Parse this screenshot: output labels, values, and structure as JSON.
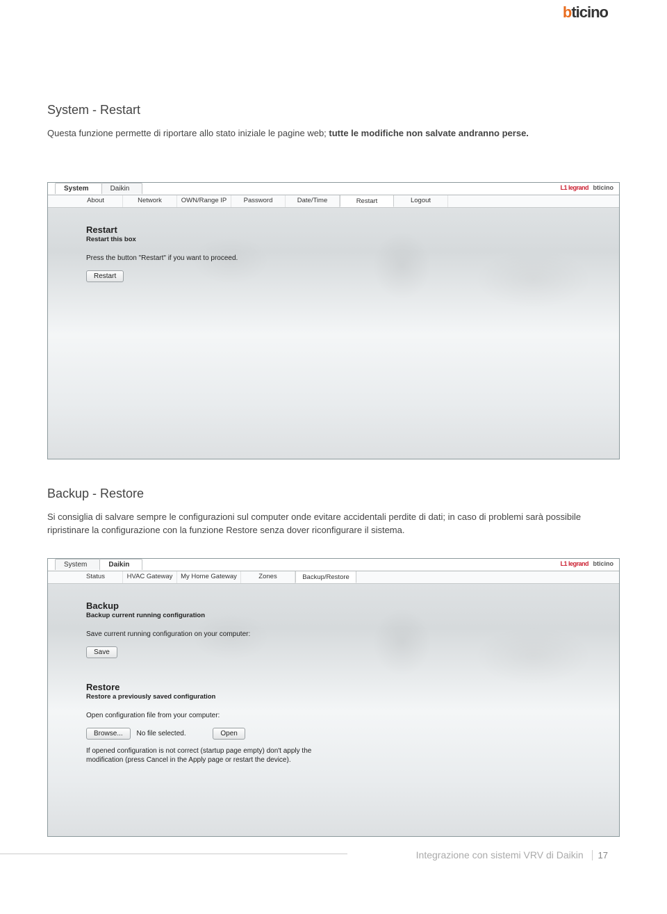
{
  "brand": {
    "part1": "b",
    "part2": "ticino"
  },
  "section1": {
    "title": "System - Restart",
    "desc_a": "Questa funzione permette di riportare allo stato iniziale le pagine web; ",
    "desc_b": "tutte le modifiche non salvate andranno perse."
  },
  "shot1": {
    "tabs": [
      "System",
      "Daikin"
    ],
    "active_tab": 0,
    "logos": {
      "legrand": "L1 legrand",
      "bticino": "bticino"
    },
    "subtabs": [
      "About",
      "Network",
      "OWN/Range IP",
      "Password",
      "Date/Time",
      "Restart",
      "Logout"
    ],
    "active_sub": 5,
    "heading": "Restart",
    "subheading": "Restart this box",
    "line": "Press the button \"Restart\" if you want to proceed.",
    "button": "Restart"
  },
  "section2": {
    "title": "Backup - Restore",
    "desc": "Si consiglia di salvare sempre le configurazioni sul computer onde evitare accidentali perdite di dati; in caso di problemi sarà possibile ripristinare la configurazione con la funzione Restore senza dover riconfigurare il sistema."
  },
  "shot2": {
    "tabs": [
      "System",
      "Daikin"
    ],
    "active_tab": 1,
    "logos": {
      "legrand": "L1 legrand",
      "bticino": "bticino"
    },
    "subtabs": [
      "Status",
      "HVAC Gateway",
      "My Home Gateway",
      "Zones",
      "Backup/Restore"
    ],
    "active_sub": 4,
    "backup_heading": "Backup",
    "backup_sub": "Backup current running configuration",
    "backup_line": "Save current running configuration on your computer:",
    "backup_btn": "Save",
    "restore_heading": "Restore",
    "restore_sub": "Restore a previously saved configuration",
    "restore_line": "Open configuration file from your computer:",
    "browse_btn": "Browse...",
    "file_label": "No file selected.",
    "open_btn": "Open",
    "note": "If opened configuration is not correct (startup page empty) don't apply the modification (press Cancel in the Apply page or restart the device)."
  },
  "footer": {
    "text": "Integrazione con sistemi VRV di Daikin",
    "page": "17"
  }
}
